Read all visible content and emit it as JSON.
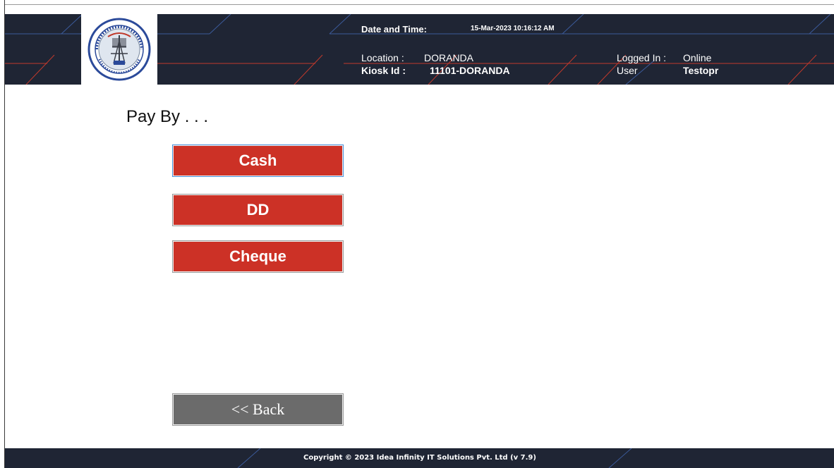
{
  "header": {
    "logo": "jbvnl-emblem",
    "datetime_label": "Date and Time:",
    "datetime_value": "15-Mar-2023 10:16:12 AM",
    "location_label": "Location :",
    "location_value": "DORANDA",
    "kiosk_label": "Kiosk Id  :",
    "kiosk_value": "11101-DORANDA",
    "logged_in_label": "Logged In :",
    "logged_in_value": "Online",
    "user_label": "User",
    "user_value": "Testopr"
  },
  "main": {
    "title": "Pay By . . .",
    "options": {
      "cash": "Cash",
      "dd": "DD",
      "cheque": "Cheque"
    },
    "back_label": "<< Back"
  },
  "footer": {
    "copyright": "Copyright © 2023 Idea Infinity IT Solutions Pvt. Ltd (v 7.9)"
  },
  "colors": {
    "header_bg": "#1f2534",
    "button_red": "#cc3126",
    "button_gray": "#6b6b6b",
    "accent_line_red": "#c0392b",
    "accent_line_blue": "#3b5a9a"
  }
}
